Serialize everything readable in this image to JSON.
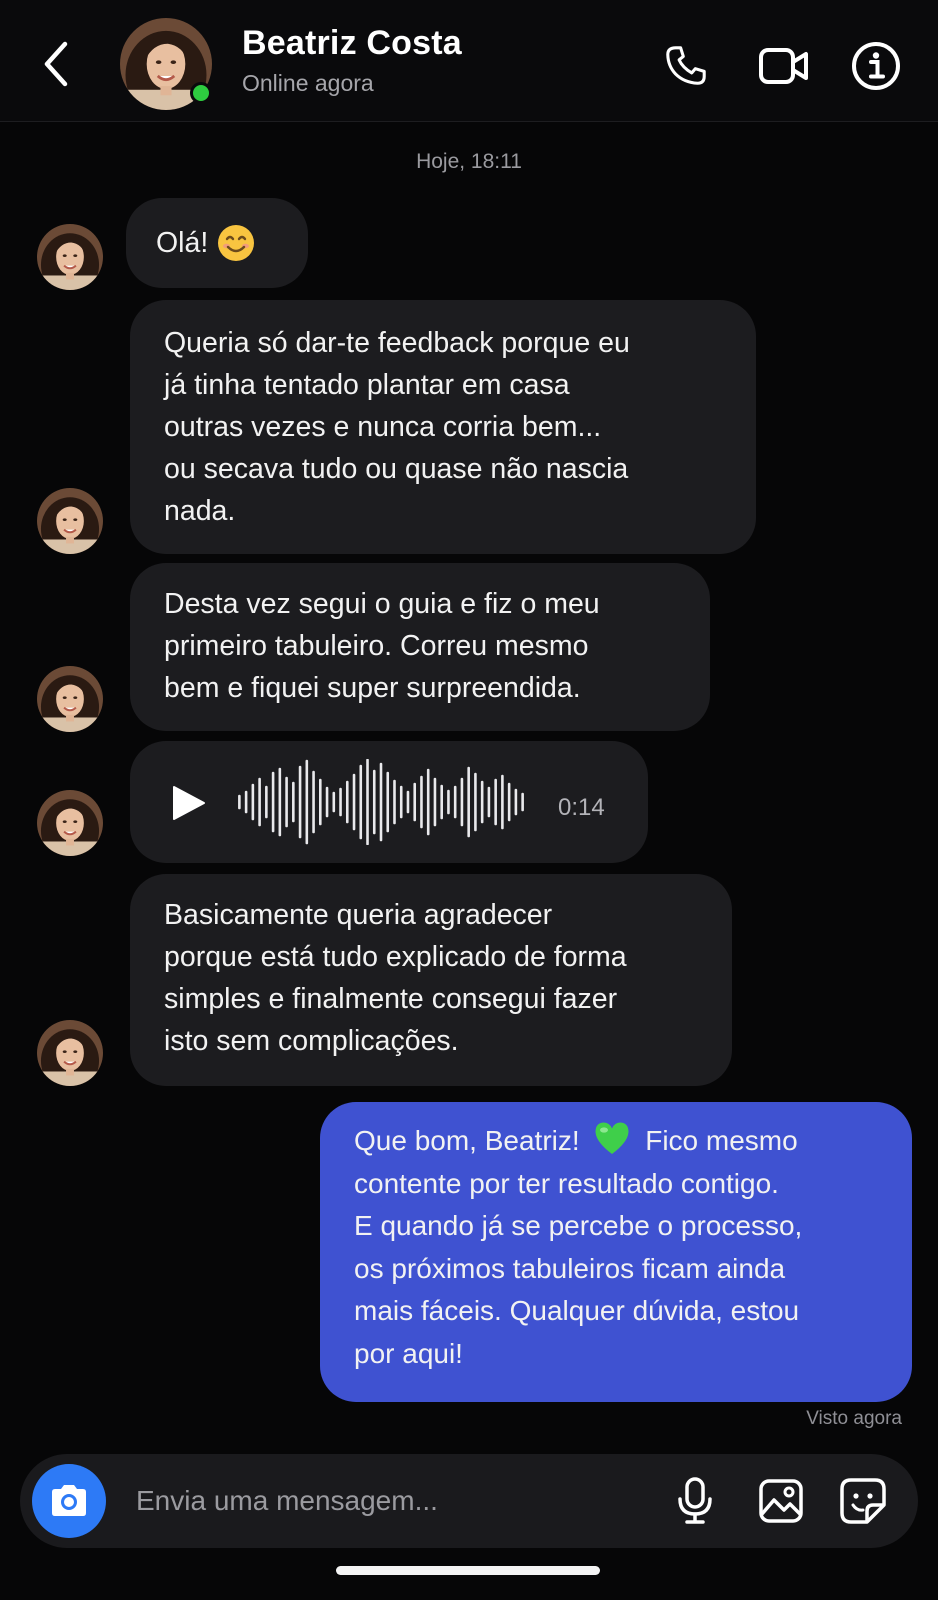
{
  "header": {
    "contact_name": "Beatriz Costa",
    "status": "Online agora",
    "icons": [
      "back-icon",
      "phone-icon",
      "video-icon",
      "info-icon"
    ]
  },
  "chat": {
    "date_label": "Hoje, 18:11",
    "messages": [
      {
        "sender": "contact",
        "text": "Olá!",
        "emoji": "smiling-face"
      },
      {
        "sender": "contact",
        "text": "Queria só dar-te feedback porque eu\njá tinha tentado plantar em casa\noutras vezes e nunca corria bem...\nou secava tudo ou quase não nascia\nnada."
      },
      {
        "sender": "contact",
        "text": "Desta vez segui o guia e fiz o meu\nprimeiro tabuleiro. Correu mesmo\nbem e fiquei super surpreendida."
      },
      {
        "sender": "contact",
        "type": "voice",
        "duration": "0:14"
      },
      {
        "sender": "contact",
        "text": "Basicamente queria agradecer\nporque está tudo explicado de forma\nsimples e finalmente consegui fazer\nisto sem complicações."
      },
      {
        "sender": "me",
        "text_before_emoji": "Que bom, Beatriz!",
        "emoji": "green-heart",
        "text_after_emoji": "Fico mesmo",
        "text_rest": "contente por ter resultado contigo.\nE quando já se percebe o processo,\nos próximos tabuleiros ficam ainda\nmais fáceis. Qualquer dúvida, estou\npor aqui!"
      }
    ],
    "seen_label": "Visto agora"
  },
  "composer": {
    "placeholder": "Envia uma mensagem...",
    "icons": [
      "camera-icon",
      "microphone-icon",
      "image-icon",
      "sticker-icon"
    ]
  },
  "colors": {
    "background": "#060607",
    "incoming_bubble": "#1c1c1f",
    "outgoing_bubble": "#3f52d1",
    "online": "#2ecc40",
    "camera_button": "#2d7af6"
  }
}
